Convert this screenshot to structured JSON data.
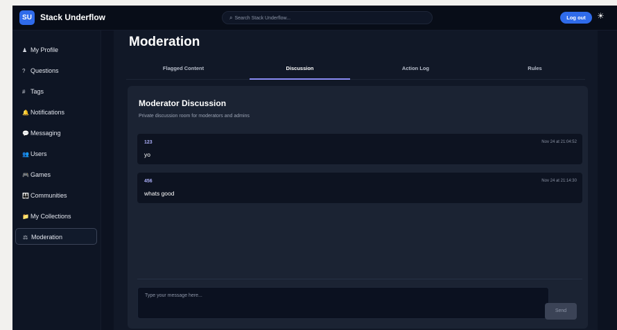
{
  "header": {
    "logo_text": "SU",
    "brand": "Stack Underflow",
    "search_icon": "⌕",
    "search_placeholder": "Search Stack Underflow...",
    "logout_label": "Log out",
    "theme_icon": "☀"
  },
  "sidebar": {
    "items": [
      {
        "icon": "♟",
        "label": "My Profile"
      },
      {
        "icon": "?",
        "label": "Questions"
      },
      {
        "icon": "#",
        "label": "Tags"
      },
      {
        "icon": "🔔",
        "label": "Notifications"
      },
      {
        "icon": "💬",
        "label": "Messaging"
      },
      {
        "icon": "👥",
        "label": "Users"
      },
      {
        "icon": "🎮",
        "label": "Games"
      },
      {
        "icon": "👪",
        "label": "Communities"
      },
      {
        "icon": "📁",
        "label": "My Collections"
      },
      {
        "icon": "⚖",
        "label": "Moderation"
      }
    ],
    "active_index": 9
  },
  "main": {
    "title": "Moderation",
    "tabs": [
      {
        "label": "Flagged Content"
      },
      {
        "label": "Discussion"
      },
      {
        "label": "Action Log"
      },
      {
        "label": "Rules"
      }
    ],
    "active_tab": 1,
    "panel": {
      "title": "Moderator Discussion",
      "subtitle": "Private discussion room for moderators and admins",
      "messages": [
        {
          "user": "123",
          "time": "Nov 24 at 21:04:52",
          "text": "yo"
        },
        {
          "user": "456",
          "time": "Nov 24 at 21:14:30",
          "text": "whats good"
        }
      ],
      "composer_placeholder": "Type your message here...",
      "send_label": "Send"
    }
  },
  "colors": {
    "accent": "#2f6bea",
    "tab_indicator": "#8b8cf5",
    "username": "#a9adf7"
  }
}
